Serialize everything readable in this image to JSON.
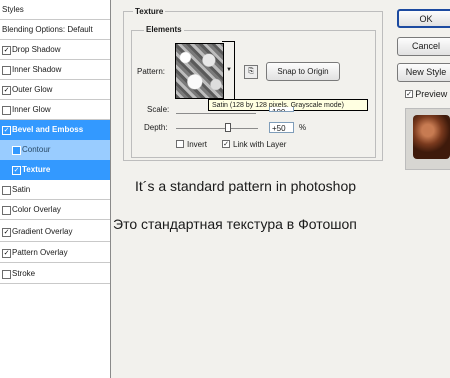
{
  "styles_panel": {
    "header": "Styles",
    "blending_options": "Blending Options: Default",
    "items": [
      {
        "label": "Drop Shadow",
        "checked": true
      },
      {
        "label": "Inner Shadow",
        "checked": false
      },
      {
        "label": "Outer Glow",
        "checked": true
      },
      {
        "label": "Inner Glow",
        "checked": false
      },
      {
        "label": "Bevel and Emboss",
        "checked": true
      },
      {
        "label": "Contour",
        "checked": false
      },
      {
        "label": "Texture",
        "checked": true
      },
      {
        "label": "Satin",
        "checked": false
      },
      {
        "label": "Color Overlay",
        "checked": false
      },
      {
        "label": "Gradient Overlay",
        "checked": true
      },
      {
        "label": "Pattern Overlay",
        "checked": true
      },
      {
        "label": "Stroke",
        "checked": false
      }
    ]
  },
  "texture": {
    "group_title": "Texture",
    "elements_title": "Elements",
    "pattern_label": "Pattern:",
    "snap_button": "Snap to Origin",
    "tooltip": "Satin (128 by 128 pixels, Grayscale mode)",
    "scale_label": "Scale:",
    "scale_value": "100",
    "depth_label": "Depth:",
    "depth_value": "+50",
    "depth_unit": "%",
    "invert_label": "Invert",
    "invert_checked": false,
    "link_label": "Link with Layer",
    "link_checked": true
  },
  "buttons": {
    "ok": "OK",
    "cancel": "Cancel",
    "new_style": "New Style",
    "preview_label": "Preview",
    "preview_checked": true
  },
  "captions": {
    "english": "It´s a standard pattern in photoshop",
    "russian": "Это стандартная текстура в Фотошоп"
  },
  "check_mark": "✓"
}
